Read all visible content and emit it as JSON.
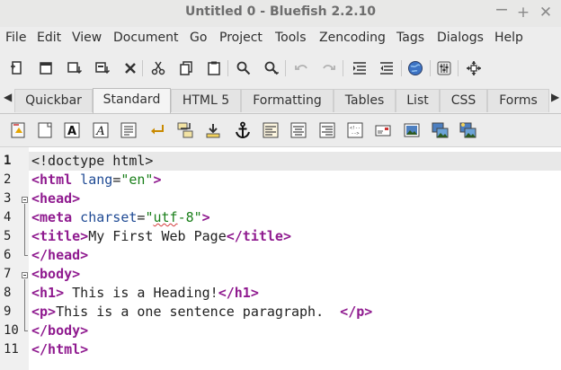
{
  "window": {
    "title": "Untitled 0 - Bluefish 2.2.10",
    "controls": [
      "minimize",
      "maximize",
      "close"
    ]
  },
  "menu": [
    "File",
    "Edit",
    "View",
    "Document",
    "Go",
    "Project",
    "Tools",
    "Zencoding",
    "Tags",
    "Dialogs",
    "Help"
  ],
  "toolbar": {
    "buttons": [
      "new-file-icon",
      "open-file-icon",
      "save-icon",
      "save-as-icon",
      "close-icon",
      "cut-icon",
      "copy-icon",
      "paste-icon",
      "find-icon",
      "find-replace-icon",
      "undo-icon",
      "redo-icon",
      "indent-icon",
      "unindent-icon",
      "preview-browser-icon",
      "preferences-icon",
      "fullscreen-icon"
    ]
  },
  "tabs": {
    "items": [
      "Quickbar",
      "Standard",
      "HTML 5",
      "Formatting",
      "Tables",
      "List",
      "CSS",
      "Forms"
    ],
    "active": "Standard"
  },
  "html_toolbar": {
    "buttons": [
      "quickstart-icon",
      "body-icon",
      "bold-icon",
      "italic-icon",
      "paragraph-icon",
      "break-icon",
      "break-clear-icon",
      "nbsp-icon",
      "anchor-icon",
      "align-left-icon",
      "center-icon",
      "align-right-icon",
      "comment-icon",
      "email-icon",
      "image-icon",
      "thumbnail-icon",
      "multi-thumbnail-icon"
    ]
  },
  "editor": {
    "current_line": 1,
    "lines": [
      {
        "n": "1",
        "t": "<!doctype html>"
      },
      {
        "n": "2",
        "t": "<html lang=\"en\">"
      },
      {
        "n": "3",
        "t": "<head>"
      },
      {
        "n": "4",
        "t": "<meta charset=\"utf-8\">"
      },
      {
        "n": "5",
        "t": "<title>My First Web Page</title>"
      },
      {
        "n": "6",
        "t": "</head>"
      },
      {
        "n": "7",
        "t": "<body>"
      },
      {
        "n": "8",
        "t": "<h1> This is a Heading!</h1>"
      },
      {
        "n": "9",
        "t": "<p>This is a one sentence paragraph.  </p>"
      },
      {
        "n": "10",
        "t": "</body>"
      },
      {
        "n": "11",
        "t": "</html>"
      }
    ],
    "segments": {
      "l1": "<!doctype html>",
      "l2a": "<html",
      "l2b": " lang",
      "l2c": "=",
      "l2d": "\"en\"",
      "l2e": ">",
      "l3": "<head>",
      "l4a": "<meta",
      "l4b": " charset",
      "l4c": "=",
      "l4d": "\"",
      "l4e": "utf",
      "l4f": "-8\"",
      "l4g": ">",
      "l5a": "<title>",
      "l5b": "My First Web Page",
      "l5c": "</title>",
      "l6": "</head>",
      "l7": "<body>",
      "l8a": "<h1>",
      "l8b": " This is a Heading!",
      "l8c": "</h1>",
      "l9a": "<p>",
      "l9b": "This is a one sentence paragraph.  ",
      "l9c": "</p>",
      "l10": "</body>",
      "l11": "</html>"
    }
  },
  "colors": {
    "tag": "#8f1a8f",
    "attribute": "#1f4a94",
    "string": "#1a7f1a",
    "current_line_bg": "#e8e8e8"
  }
}
